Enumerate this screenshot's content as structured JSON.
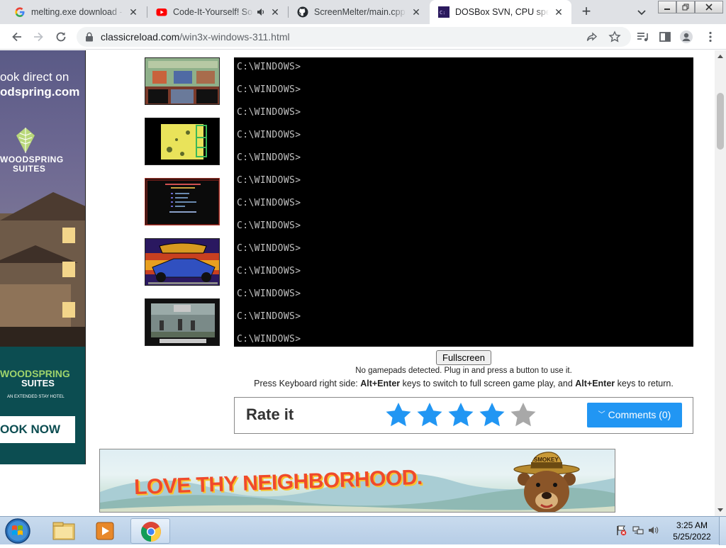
{
  "browser": {
    "tabs": [
      {
        "title": "melting.exe download - G",
        "favicon": "google-icon",
        "active": false
      },
      {
        "title": "Code-It-Yourself! So",
        "favicon": "youtube-icon",
        "active": false,
        "audio": true
      },
      {
        "title": "ScreenMelter/main.cpp a",
        "favicon": "github-icon",
        "active": false
      },
      {
        "title": "DOSBox SVN, CPU speed",
        "favicon": "dosbox-icon",
        "active": true
      }
    ],
    "url_domain": "classicreload.com",
    "url_path": "/win3x-windows-311.html"
  },
  "left_ad": {
    "line1": "ook direct on",
    "line2": "odspring.com",
    "brand_top": "WOODSPRING",
    "brand_bottom": "SUITES",
    "lower_brand": "WOODSPRING",
    "lower_suites": "SUITES",
    "tagline": "AN EXTENDED STAY HOTEL",
    "cta": "OOK NOW"
  },
  "dos": {
    "prompt": "C:\\WINDOWS>",
    "line_count": 13
  },
  "player": {
    "fullscreen_label": "Fullscreen",
    "gamepad_msg": "No gamepads detected. Plug in and press a button to use it.",
    "kb_pre": "Press Keyboard right side: ",
    "kb_key1": "Alt+Enter",
    "kb_mid": " keys to switch to full screen game play, and ",
    "kb_key2": "Alt+Enter",
    "kb_post": " keys to return."
  },
  "rating": {
    "label": "Rate it",
    "stars_filled": 4,
    "stars_total": 5,
    "comments_label": "Comments (0)"
  },
  "bottom_ad": {
    "headline": "LOVE THY NEIGHBORHOOD.",
    "badge": "SMOKEY"
  },
  "taskbar": {
    "time": "3:25 AM",
    "date": "5/25/2022"
  },
  "colors": {
    "star_filled": "#2196f3",
    "star_empty": "#a8a8a8",
    "comments_bg": "#2196f3",
    "dos_text": "#c0c0c0"
  }
}
